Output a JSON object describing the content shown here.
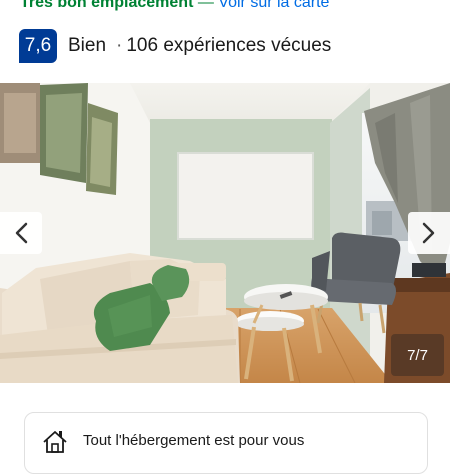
{
  "location": {
    "rating_label": "Très bon emplacement",
    "separator": "—",
    "map_link": "Voir sur la carte"
  },
  "rating": {
    "score": "7,6",
    "word": "Bien",
    "separator": "·",
    "reviews": "106 expériences vécues"
  },
  "gallery": {
    "counter": "7/7",
    "icons": {
      "prev": "chevron-left-icon",
      "next": "chevron-right-icon"
    }
  },
  "info_card": {
    "icon": "house-icon",
    "text": "Tout l'hébergement est pour vous"
  },
  "colors": {
    "score_badge": "#003b95",
    "location_green": "#008234",
    "link_blue": "#006ce4"
  }
}
